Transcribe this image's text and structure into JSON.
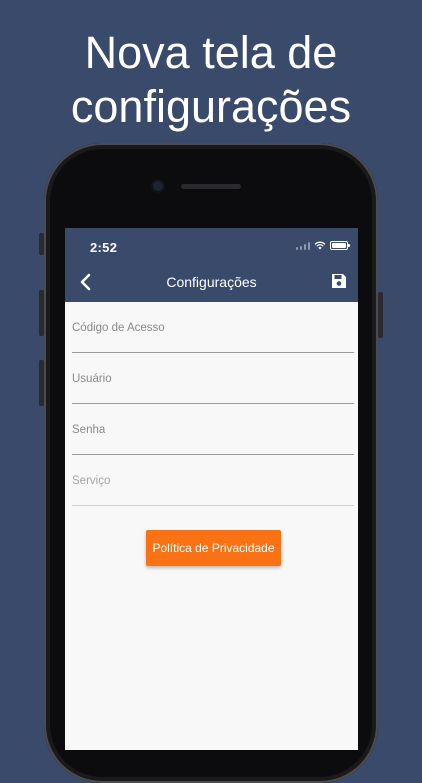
{
  "headline": {
    "line1": "Nova tela de",
    "line2": "configurações"
  },
  "status_bar": {
    "time": "2:52"
  },
  "app_bar": {
    "title": "Configurações",
    "back_icon": "chevron-left-icon",
    "save_icon": "floppy-disk-icon"
  },
  "form": {
    "fields": [
      {
        "placeholder": "Código de Acesso",
        "value": ""
      },
      {
        "placeholder": "Usuário",
        "value": ""
      },
      {
        "placeholder": "Senha",
        "value": ""
      },
      {
        "placeholder": "Serviço",
        "value": ""
      }
    ],
    "privacy_button": "Política de Privacidade"
  },
  "colors": {
    "background": "#3a4a6b",
    "app_bar": "#3a4a6b",
    "accent": "#f97316",
    "screen": "#f8f8f8"
  }
}
